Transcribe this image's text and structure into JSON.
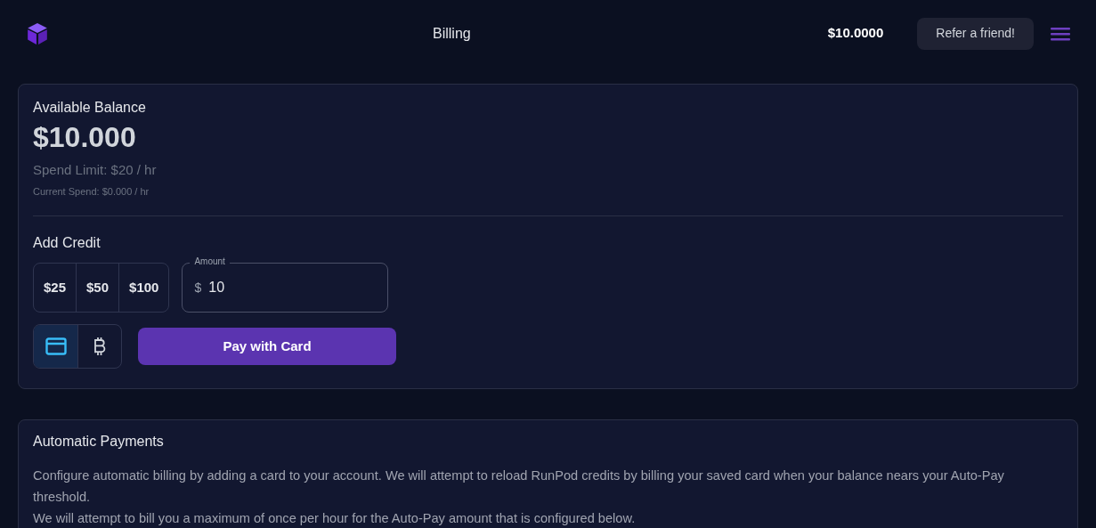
{
  "header": {
    "title": "Billing",
    "balance": "$10.0000",
    "refer_button": "Refer a friend!"
  },
  "balance_card": {
    "title": "Available Balance",
    "amount": "$10.000",
    "spend_limit": "Spend Limit: $20 / hr",
    "current_spend": "Current Spend: $0.000 / hr"
  },
  "add_credit": {
    "title": "Add Credit",
    "presets": [
      "$25",
      "$50",
      "$100"
    ],
    "amount_field": {
      "label": "Amount",
      "prefix": "$",
      "value": "10"
    },
    "payment_methods": [
      {
        "kind": "card",
        "selected": true
      },
      {
        "kind": "bitcoin",
        "selected": false
      }
    ],
    "pay_button": "Pay with Card"
  },
  "automatic_payments": {
    "title": "Automatic Payments",
    "paragraphs": [
      "Configure automatic billing by adding a card to your account. We will attempt to reload RunPod credits by billing your saved card when your balance nears your Auto-Pay threshold.",
      "We will attempt to bill you a maximum of once per hour for the Auto-Pay amount that is configured below."
    ]
  }
}
